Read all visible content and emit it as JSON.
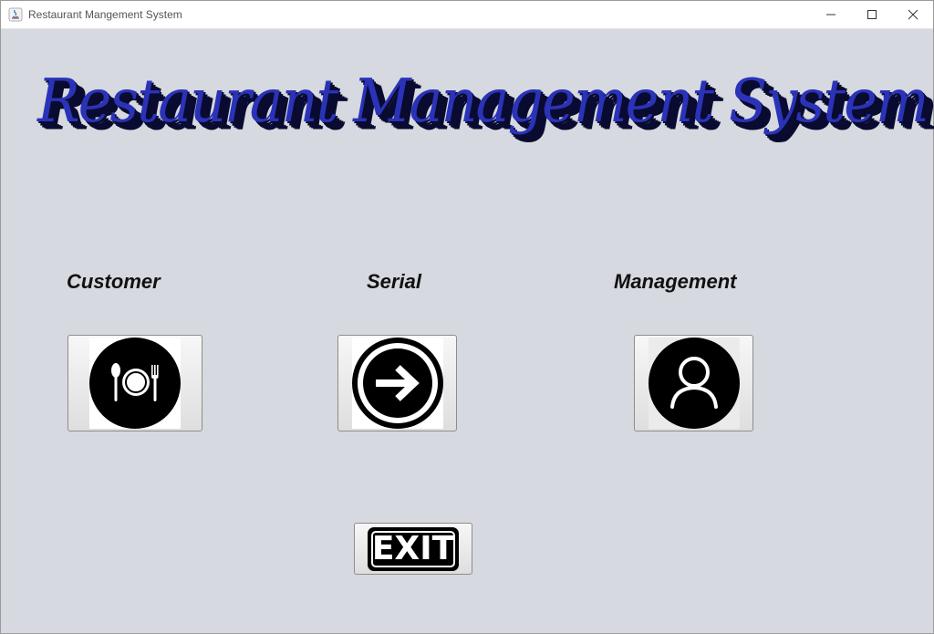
{
  "window": {
    "title": "Restaurant Mangement System",
    "controls": [
      "minimize-icon",
      "maximize-icon",
      "close-icon"
    ]
  },
  "banner": {
    "text": "Restaurant Management System",
    "color": "#2a33b8"
  },
  "sections": [
    {
      "label": "Customer",
      "icon": "dining-plate-icon"
    },
    {
      "label": "Serial",
      "icon": "arrow-right-circle-icon"
    },
    {
      "label": "Management",
      "icon": "user-icon"
    }
  ],
  "exit": {
    "label": "EXIT"
  }
}
